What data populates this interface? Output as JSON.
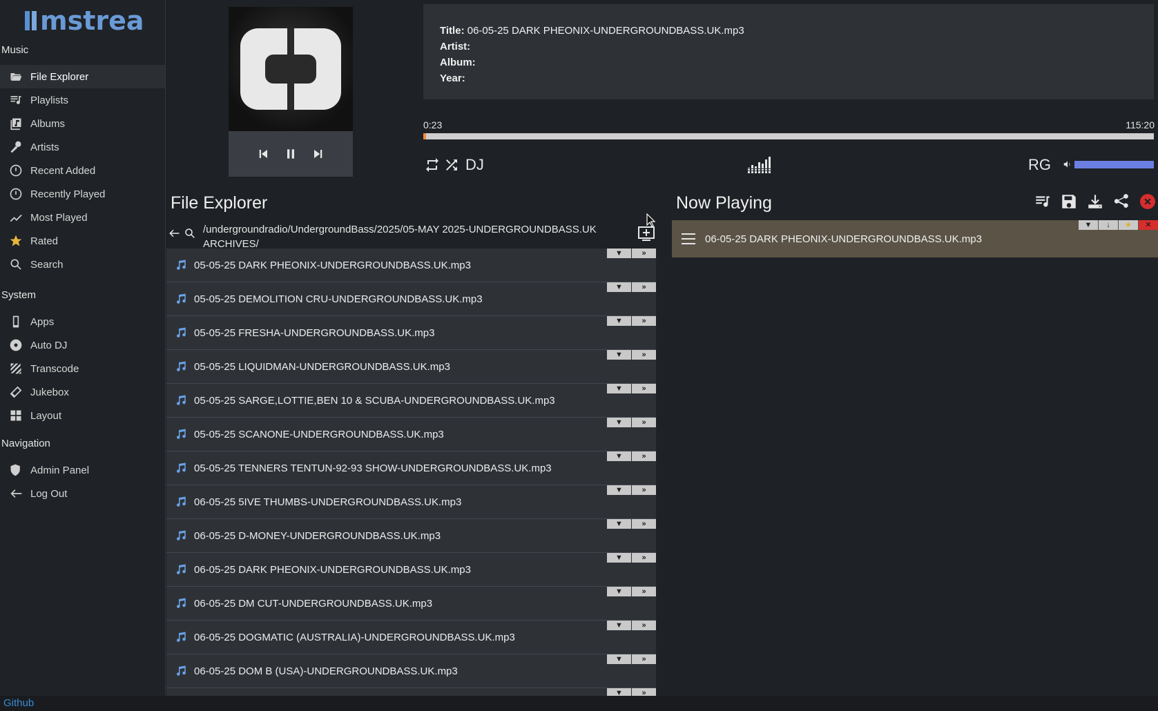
{
  "app": {
    "logo_text": "mstream"
  },
  "sidebar": {
    "music_header": "Music",
    "music_items": [
      {
        "label": "File Explorer",
        "icon": "folder-open-icon",
        "active": true
      },
      {
        "label": "Playlists",
        "icon": "playlist-icon"
      },
      {
        "label": "Albums",
        "icon": "album-icon"
      },
      {
        "label": "Artists",
        "icon": "microphone-icon"
      },
      {
        "label": "Recent Added",
        "icon": "clock-icon"
      },
      {
        "label": "Recently Played",
        "icon": "clock-icon"
      },
      {
        "label": "Most Played",
        "icon": "trend-icon"
      },
      {
        "label": "Rated",
        "icon": "star-icon"
      },
      {
        "label": "Search",
        "icon": "search-icon"
      }
    ],
    "system_header": "System",
    "system_items": [
      {
        "label": "Apps",
        "icon": "phone-icon"
      },
      {
        "label": "Auto DJ",
        "icon": "disc-icon"
      },
      {
        "label": "Transcode",
        "icon": "transcode-icon"
      },
      {
        "label": "Jukebox",
        "icon": "remote-icon"
      },
      {
        "label": "Layout",
        "icon": "layout-icon"
      }
    ],
    "navigation_header": "Navigation",
    "navigation_items": [
      {
        "label": "Admin Panel",
        "icon": "admin-shield-icon"
      },
      {
        "label": "Log Out",
        "icon": "arrow-left-icon"
      }
    ]
  },
  "player": {
    "title_label": "Title:",
    "title_value": "06-05-25 DARK PHEONIX-UNDERGROUNDBASS.UK.mp3",
    "artist_label": "Artist:",
    "artist_value": "",
    "album_label": "Album:",
    "album_value": "",
    "year_label": "Year:",
    "year_value": "",
    "current_time": "0:23",
    "total_time": "115:20",
    "progress_fraction": 0.0033,
    "volume_fraction": 1.0,
    "dj_label": "DJ",
    "rg_label": "RG",
    "colors": {
      "progress": "#f08a3c",
      "volume": "#6b7fe3"
    }
  },
  "file_explorer": {
    "title": "File Explorer",
    "path": "/undergroundradio/UndergroundBass/2025/05-MAY 2025-UNDERGROUNDBASS.UK ARCHIVES/",
    "files": [
      "05-05-25 DARK PHEONIX-UNDERGROUNDBASS.UK.mp3",
      "05-05-25 DEMOLITION CRU-UNDERGROUNDBASS.UK.mp3",
      "05-05-25 FRESHA-UNDERGROUNDBASS.UK.mp3",
      "05-05-25 LIQUIDMAN-UNDERGROUNDBASS.UK.mp3",
      "05-05-25 SARGE,LOTTIE,BEN 10 & SCUBA-UNDERGROUNDBASS.UK.mp3",
      "05-05-25 SCANONE-UNDERGROUNDBASS.UK.mp3",
      "05-05-25 TENNERS TENTUN-92-93 SHOW-UNDERGROUNDBASS.UK.mp3",
      "06-05-25 5IVE THUMBS-UNDERGROUNDBASS.UK.mp3",
      "06-05-25 D-MONEY-UNDERGROUNDBASS.UK.mp3",
      "06-05-25 DARK PHEONIX-UNDERGROUNDBASS.UK.mp3",
      "06-05-25 DM CUT-UNDERGROUNDBASS.UK.mp3",
      "06-05-25 DOGMATIC (AUSTRALIA)-UNDERGROUNDBASS.UK.mp3",
      "06-05-25 DOM B (USA)-UNDERGROUNDBASS.UK.mp3",
      ""
    ],
    "row_btn_dropdown": "▼",
    "row_btn_add": "»"
  },
  "now_playing": {
    "title": "Now Playing",
    "items": [
      "06-05-25 DARK PHEONIX-UNDERGROUNDBASS.UK.mp3"
    ]
  },
  "footer": {
    "link": "Github"
  }
}
